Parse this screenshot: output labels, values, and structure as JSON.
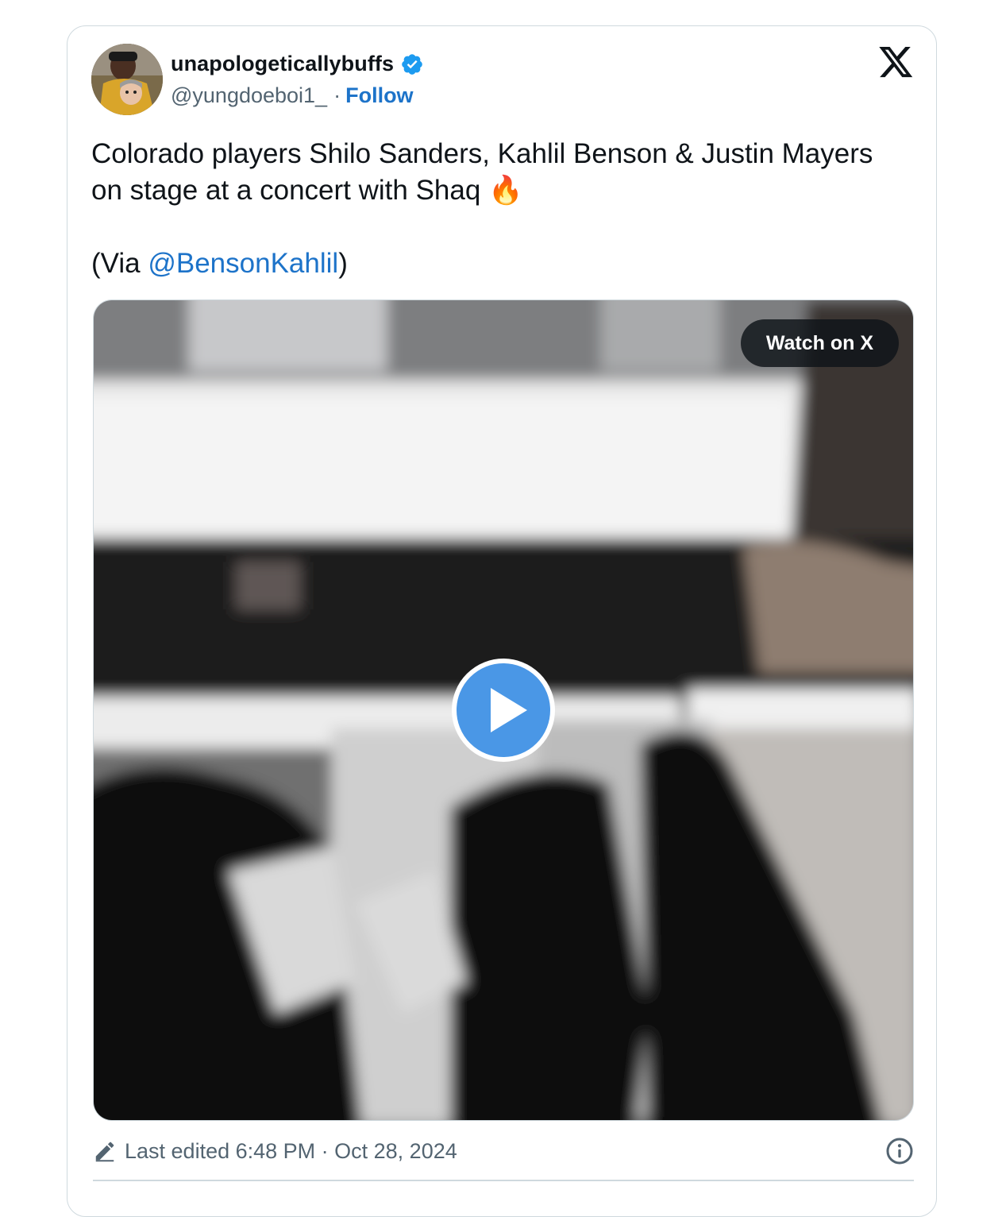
{
  "tweet": {
    "display_name": "unapologeticallybuffs",
    "handle": "@yungdoeboi1_",
    "separator": "·",
    "follow_label": "Follow",
    "text_line1": "Colorado players Shilo Sanders, Kahlil Benson & Justin Mayers on stage at a concert with Shaq",
    "emoji": "🔥",
    "via_prefix": "(Via ",
    "via_mention": "@BensonKahlil",
    "via_suffix": ")"
  },
  "media": {
    "watch_label": "Watch on X"
  },
  "footer": {
    "edited_label": "Last edited 6:48 PM · Oct 28, 2024"
  },
  "icons": {
    "verified": "verified-badge-icon",
    "logo": "x-logo-icon",
    "play": "play-icon",
    "pencil": "pencil-icon",
    "info": "info-icon"
  },
  "colors": {
    "link": "#1d73c9",
    "verified": "#1d9bf0",
    "play": "#4a97e6",
    "secondary_text": "#536471"
  }
}
